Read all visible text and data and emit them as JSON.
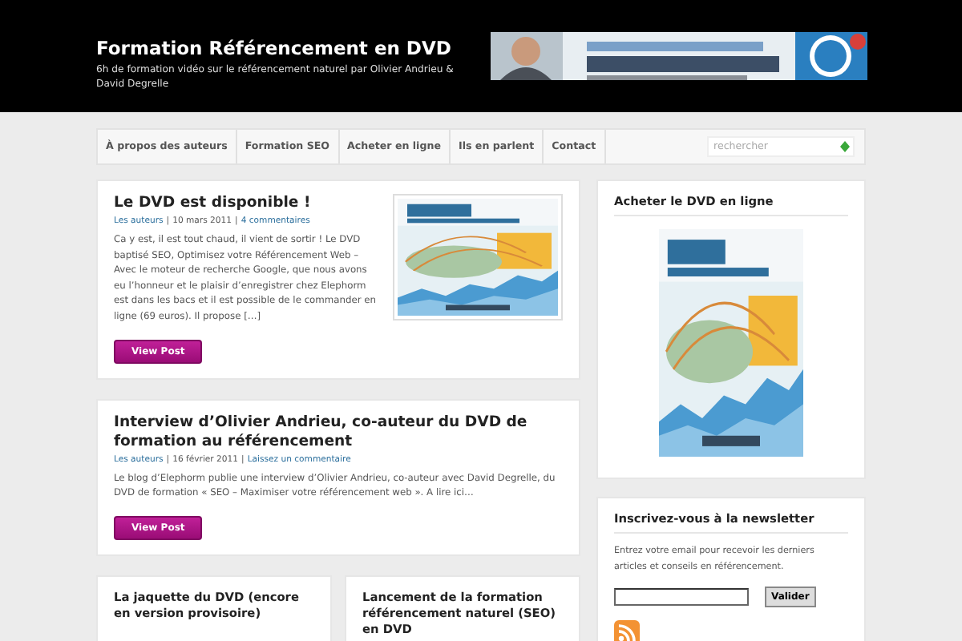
{
  "header": {
    "title": "Formation Référencement en DVD",
    "tagline": "6h de formation vidéo sur le référencement naturel par Olivier Andrieu & David Degrelle"
  },
  "nav": {
    "items": [
      {
        "label": "À propos des auteurs"
      },
      {
        "label": "Formation SEO"
      },
      {
        "label": "Acheter en ligne"
      },
      {
        "label": "Ils en parlent"
      },
      {
        "label": "Contact"
      }
    ],
    "search": {
      "placeholder": "rechercher"
    }
  },
  "posts": [
    {
      "title": "Le DVD est disponible !",
      "meta": [
        {
          "kind": "link",
          "text": "Les auteurs"
        },
        {
          "kind": "text",
          "text": "|"
        },
        {
          "kind": "text",
          "text": "10 mars 2011"
        },
        {
          "kind": "text",
          "text": "|"
        },
        {
          "kind": "link",
          "text": "4 commentaires"
        }
      ],
      "excerpt": "Ca y est, il est tout chaud, il vient de sortir ! Le DVD baptisé SEO, Optimisez votre Référencement Web – Avec le moteur de recherche Google, que nous avons eu l’honneur et le plaisir d’enregistrer chez Elephorm est dans les bacs et il est possible de le commander en ligne (69 euros). Il propose […]",
      "button": "View Post"
    },
    {
      "title": "Interview d’Olivier Andrieu, co-auteur du DVD de formation au référencement",
      "meta": [
        {
          "kind": "link",
          "text": "Les auteurs"
        },
        {
          "kind": "text",
          "text": "|"
        },
        {
          "kind": "text",
          "text": "16 février 2011"
        },
        {
          "kind": "text",
          "text": "|"
        },
        {
          "kind": "link",
          "text": "Laissez un commentaire"
        }
      ],
      "excerpt": "Le blog d’Elephorm publie une interview d’Olivier Andrieu, co-auteur avec David Degrelle, du DVD de formation  « SEO – Maximiser votre référencement web ». A lire ici…",
      "button": "View Post"
    }
  ],
  "small_posts": [
    {
      "title": "La jaquette du DVD (encore en version provisoire)"
    },
    {
      "title": "Lancement de la formation référencement naturel (SEO) en DVD"
    }
  ],
  "sidebar": {
    "buy": {
      "title": "Acheter le DVD en ligne"
    },
    "newsletter": {
      "title": "Inscrivez-vous à la newsletter",
      "text": "Entrez votre email pour recevoir les derniers articles et conseils en référencement.",
      "button": "Valider"
    }
  }
}
